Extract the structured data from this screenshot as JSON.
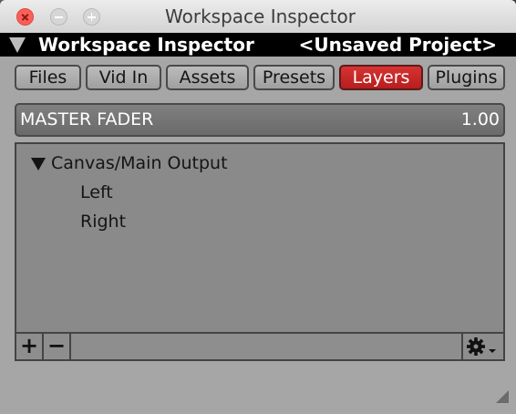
{
  "window": {
    "title": "Workspace Inspector"
  },
  "header": {
    "title": "Workspace Inspector",
    "project": "<Unsaved Project>",
    "collapse_icon": "triangle-down-icon"
  },
  "tabs": [
    {
      "label": "Files",
      "active": false
    },
    {
      "label": "Vid In",
      "active": false
    },
    {
      "label": "Assets",
      "active": false
    },
    {
      "label": "Presets",
      "active": false
    },
    {
      "label": "Layers",
      "active": true
    },
    {
      "label": "Plugins",
      "active": false
    }
  ],
  "fader": {
    "label": "MASTER FADER",
    "value": "1.00"
  },
  "tree": {
    "root": {
      "label": "Canvas/Main Output",
      "expanded": true,
      "children": [
        {
          "label": "Left"
        },
        {
          "label": "Right"
        }
      ]
    }
  },
  "footer": {
    "add_label": "+",
    "remove_label": "−",
    "settings_icon": "gear-icon"
  },
  "colors": {
    "accent_active_tab": "#c62828",
    "panel_bg": "#a6a6a6",
    "header_bg": "#000000"
  }
}
